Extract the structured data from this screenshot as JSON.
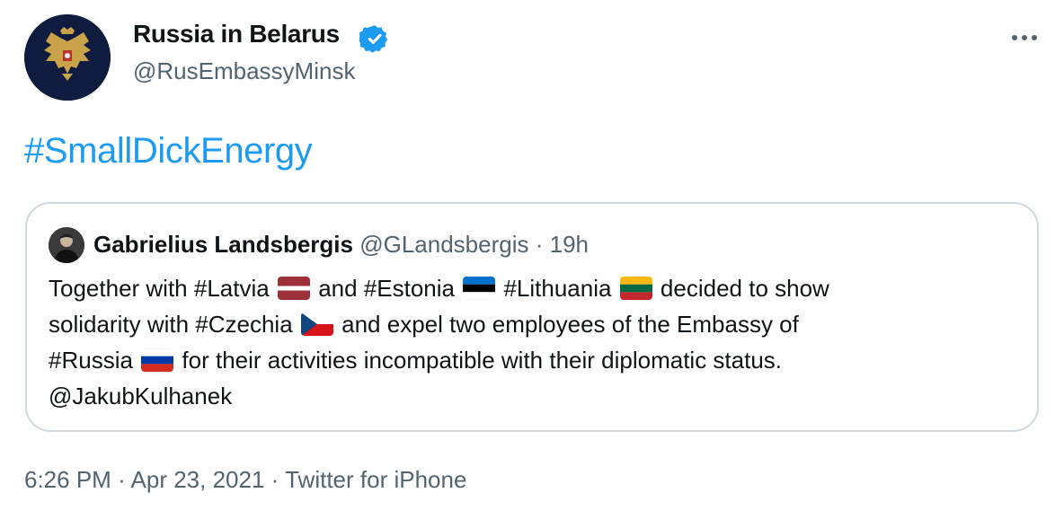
{
  "author": {
    "display_name": "Russia in Belarus",
    "handle": "@RusEmbassyMinsk",
    "avatar_icon": "russian-coat-of-arms-icon"
  },
  "tweet": {
    "hashtag": "#SmallDickEnergy"
  },
  "quoted": {
    "name": "Gabrielius Landsbergis",
    "handle": "@GLandsbergis",
    "separator": "·",
    "time": "19h",
    "line1_a": "Together with #Latvia",
    "line1_b": "and #Estonia",
    "line1_c": "#Lithuania",
    "line1_d": "decided to show",
    "line2_a": "solidarity with #Czechia",
    "line2_b": "and expel two employees of the Embassy of",
    "line3_a": "#Russia",
    "line3_b": "for their activities incompatible with their diplomatic status.",
    "line4": "@JakubKulhanek"
  },
  "footer": {
    "time": "6:26 PM",
    "sep1": "·",
    "date": "Apr 23, 2021",
    "sep2": "·",
    "source": "Twitter for iPhone"
  },
  "colors": {
    "link": "#1d9bf0",
    "secondary_text": "#536471",
    "border": "#cfd9de",
    "verified": "#1d9bf0"
  }
}
